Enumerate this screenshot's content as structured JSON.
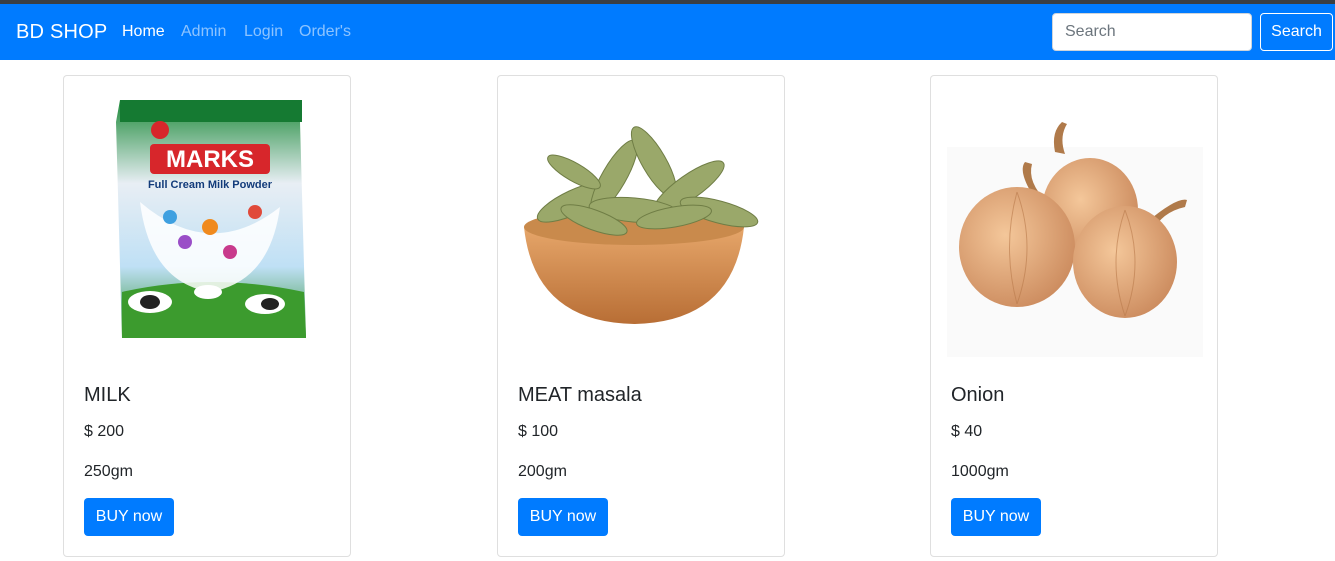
{
  "navbar": {
    "brand": "BD SHOP",
    "links": [
      {
        "label": "Home",
        "active": true
      },
      {
        "label": "Admin",
        "active": false
      },
      {
        "label": "Login",
        "active": false
      },
      {
        "label": "Order's",
        "active": false
      }
    ],
    "search": {
      "placeholder": "Search",
      "value": "",
      "button_label": "Search"
    }
  },
  "colors": {
    "primary": "#007bff",
    "text": "#212529",
    "card_border": "#dfdfdf"
  },
  "products": [
    {
      "name": "MILK",
      "price": "$ 200",
      "weight": "250gm",
      "button_label": "BUY now",
      "image": "milk-powder-pack-image"
    },
    {
      "name": "MEAT masala",
      "price": "$ 100",
      "weight": "200gm",
      "button_label": "BUY now",
      "image": "bay-leaves-bowl-image"
    },
    {
      "name": "Onion",
      "price": "$ 40",
      "weight": "1000gm",
      "button_label": "BUY now",
      "image": "onions-image"
    }
  ]
}
